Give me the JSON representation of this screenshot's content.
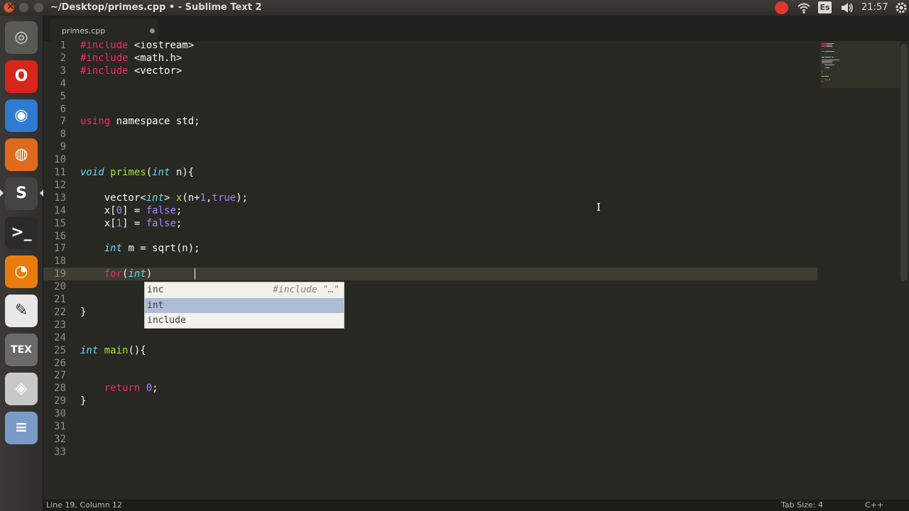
{
  "window": {
    "title": "~/Desktop/primes.cpp • - Sublime Text 2"
  },
  "panel": {
    "keyboard_layout": "Es",
    "clock": "21:57"
  },
  "launcher": {
    "items": [
      {
        "name": "dash-home",
        "glyph": "◎",
        "color": "#d6d6d6",
        "bg": "#5a5a55"
      },
      {
        "name": "opera",
        "glyph": "O",
        "color": "#ffffff",
        "bg": "#d8261a"
      },
      {
        "name": "chromium",
        "glyph": "◉",
        "color": "#ffffff",
        "bg": "#2e7bd0"
      },
      {
        "name": "firefox",
        "glyph": "◍",
        "color": "#ffffff",
        "bg": "#e06a1c"
      },
      {
        "name": "sublime-text",
        "glyph": "S",
        "color": "#ffffff",
        "bg": "#444444"
      },
      {
        "name": "terminal",
        "glyph": ">_",
        "color": "#ffffff",
        "bg": "#2b2b2b"
      },
      {
        "name": "blender",
        "glyph": "◔",
        "color": "#ffffff",
        "bg": "#e87d0d"
      },
      {
        "name": "text-editor",
        "glyph": "✎",
        "color": "#333333",
        "bg": "#e8e8e8"
      },
      {
        "name": "texmaker",
        "glyph": "TEX",
        "color": "#ffffff",
        "bg": "#6a6a6a"
      },
      {
        "name": "libreoffice",
        "glyph": "◈",
        "color": "#ffffff",
        "bg": "#c8c8c8"
      },
      {
        "name": "app-stack",
        "glyph": "≡",
        "color": "#ffffff",
        "bg": "#7a9ac8"
      }
    ]
  },
  "tab": {
    "label": "primes.cpp"
  },
  "editor": {
    "line_numbers": [
      "1",
      "2",
      "3",
      "4",
      "5",
      "6",
      "7",
      "8",
      "9",
      "10",
      "11",
      "12",
      "13",
      "14",
      "15",
      "16",
      "17",
      "18",
      "19",
      "20",
      "21",
      "22",
      "23",
      "24",
      "25",
      "26",
      "27",
      "28",
      "29",
      "30",
      "31",
      "32",
      "33"
    ],
    "lines": [
      [
        {
          "c": "kw",
          "t": "#include"
        },
        {
          "c": "lib",
          "t": " <iostream>"
        }
      ],
      [
        {
          "c": "kw",
          "t": "#include"
        },
        {
          "c": "lib",
          "t": " <math.h>"
        }
      ],
      [
        {
          "c": "kw",
          "t": "#include"
        },
        {
          "c": "lib",
          "t": " <vector>"
        }
      ],
      [],
      [],
      [],
      [
        {
          "c": "kw",
          "t": "using"
        },
        {
          "c": "",
          "t": " namespace std;"
        }
      ],
      [],
      [],
      [],
      [
        {
          "c": "ty",
          "t": "void"
        },
        {
          "c": "",
          "t": " "
        },
        {
          "c": "fn",
          "t": "primes"
        },
        {
          "c": "",
          "t": "("
        },
        {
          "c": "ty",
          "t": "int"
        },
        {
          "c": "",
          "t": " n){"
        }
      ],
      [],
      [
        {
          "c": "",
          "t": "    vector<"
        },
        {
          "c": "ty",
          "t": "int"
        },
        {
          "c": "",
          "t": "> "
        },
        {
          "c": "fn",
          "t": "x"
        },
        {
          "c": "",
          "t": "(n+"
        },
        {
          "c": "num",
          "t": "1"
        },
        {
          "c": "",
          "t": ","
        },
        {
          "c": "num",
          "t": "true"
        },
        {
          "c": "",
          "t": ");"
        }
      ],
      [
        {
          "c": "",
          "t": "    x["
        },
        {
          "c": "num",
          "t": "0"
        },
        {
          "c": "",
          "t": "] = "
        },
        {
          "c": "num",
          "t": "false"
        },
        {
          "c": "",
          "t": ";"
        }
      ],
      [
        {
          "c": "",
          "t": "    x["
        },
        {
          "c": "num",
          "t": "1"
        },
        {
          "c": "",
          "t": "] = "
        },
        {
          "c": "num",
          "t": "false"
        },
        {
          "c": "",
          "t": ";"
        }
      ],
      [],
      [
        {
          "c": "",
          "t": "    "
        },
        {
          "c": "ty",
          "t": "int"
        },
        {
          "c": "",
          "t": " m = sqrt(n);"
        }
      ],
      [],
      [
        {
          "c": "",
          "t": "    "
        },
        {
          "c": "kw",
          "t": "for"
        },
        {
          "c": "",
          "t": "("
        },
        {
          "c": "ty",
          "t": "int"
        },
        {
          "c": "",
          "t": ")"
        }
      ],
      [],
      [],
      [
        {
          "c": "",
          "t": "}"
        }
      ],
      [],
      [],
      [
        {
          "c": "ty",
          "t": "int"
        },
        {
          "c": "",
          "t": " "
        },
        {
          "c": "fn",
          "t": "main"
        },
        {
          "c": "",
          "t": "(){"
        }
      ],
      [],
      [],
      [
        {
          "c": "",
          "t": "    "
        },
        {
          "c": "kw",
          "t": "return"
        },
        {
          "c": "",
          "t": " "
        },
        {
          "c": "num",
          "t": "0"
        },
        {
          "c": "",
          "t": ";"
        }
      ],
      [
        {
          "c": "",
          "t": "}"
        }
      ],
      [],
      [],
      [],
      []
    ]
  },
  "autocomplete": {
    "items": [
      {
        "trigger": "inc",
        "hint": "#include \"…\"",
        "selected": false
      },
      {
        "trigger": "int",
        "hint": "",
        "selected": true
      },
      {
        "trigger": "include",
        "hint": "",
        "selected": false
      }
    ]
  },
  "status": {
    "position": "Line 19, Column 12",
    "tab_size": "Tab Size: 4",
    "syntax": "C++"
  }
}
